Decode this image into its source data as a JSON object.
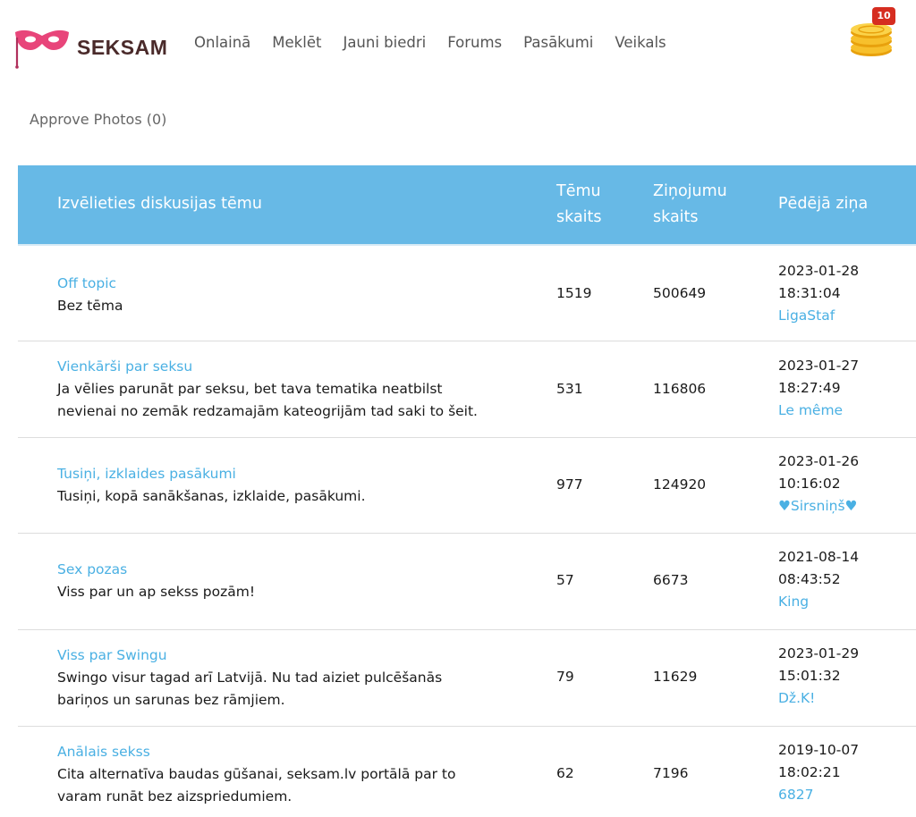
{
  "brand": {
    "name": "SEKSAM"
  },
  "nav": [
    "Onlainā",
    "Meklēt",
    "Jauni biedri",
    "Forums",
    "Pasākumi",
    "Veikals"
  ],
  "coins": {
    "badge": "10"
  },
  "approve_link": "Approve Photos (0)",
  "table": {
    "headers": {
      "topic": "Izvēlieties diskusijas tēmu",
      "topics_line1": "Tēmu",
      "topics_line2": "skaits",
      "posts_line1": "Ziņojumu",
      "posts_line2": "skaits",
      "last": "Pēdējā ziņa"
    },
    "rows": [
      {
        "title": "Off topic",
        "desc1": "Bez tēma",
        "desc2": "",
        "topics": "1519",
        "posts": "500649",
        "date": "2023-01-28",
        "time": "18:31:04",
        "user": "LigaStaf"
      },
      {
        "title": "Vienkārši par seksu",
        "desc1": "Ja vēlies parunāt par seksu, bet tava tematika neatbilst",
        "desc2": "nevienai no zemāk redzamajām kateogrijām tad saki to šeit.",
        "topics": "531",
        "posts": "116806",
        "date": "2023-01-27",
        "time": "18:27:49",
        "user": "Le même"
      },
      {
        "title": "Tusiņi, izklaides pasākumi",
        "desc1": "Tusiņi, kopā sanākšanas, izklaide, pasākumi.",
        "desc2": "",
        "topics": "977",
        "posts": "124920",
        "date": "2023-01-26",
        "time": "10:16:02",
        "user": "♥Sirsniņš♥"
      },
      {
        "title": "Sex pozas",
        "desc1": "Viss par un ap sekss pozām!",
        "desc2": "",
        "topics": "57",
        "posts": "6673",
        "date": "2021-08-14",
        "time": "08:43:52",
        "user": "King"
      },
      {
        "title": "Viss par Swingu",
        "desc1": "Swingo visur tagad arī Latvijā. Nu tad aiziet pulcēšanās",
        "desc2": "bariņos un sarunas bez rāmjiem.",
        "topics": "79",
        "posts": "11629",
        "date": "2023-01-29",
        "time": "15:01:32",
        "user": "Dž.K!"
      },
      {
        "title": "Anālais sekss",
        "desc1": "Cita alternatīva baudas gūšanai, seksam.lv portālā par to",
        "desc2": "varam runāt bez aizspriedumiem.",
        "topics": "62",
        "posts": "7196",
        "date": "2019-10-07",
        "time": "18:02:21",
        "user": "6827"
      }
    ]
  },
  "colors": {
    "header_bg": "#67b9e6",
    "link": "#4ab0e3",
    "brand_pink": "#e8457a",
    "badge": "#d62d20"
  }
}
